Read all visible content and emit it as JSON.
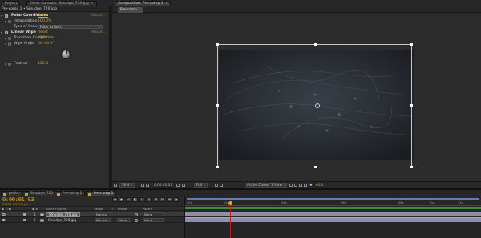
{
  "top_tabs": [
    {
      "label": "Project"
    },
    {
      "label": "Effect Controls: Smudge_720.jpg"
    },
    {
      "label": "Composition: Pre-comp 1"
    }
  ],
  "effect_controls": {
    "header": "Pre-comp 1 • Smudge_720.jpg",
    "polar": {
      "name": "Polar Coordinates",
      "reset": "Reset",
      "about": "About...",
      "interpolation_label": "Interpolation",
      "interpolation_value": "100.0%",
      "conversion_label": "Type of Conversion",
      "conversion_value": "Polar to Rect"
    },
    "wipe": {
      "name": "Linear Wipe",
      "reset": "Reset",
      "about": "About...",
      "completion_label": "Transition Completion",
      "completion_value": "31%",
      "angle_label": "Wipe Angle",
      "angle_value": "0x +0.0°",
      "feather_label": "Feather",
      "feather_value": "182.0"
    }
  },
  "composition": {
    "subtab": "Pre-comp 1"
  },
  "viewer_controls": {
    "zoom": "50%",
    "timecode": "0:00:01:03",
    "resolution": "Full",
    "camera": "Active Camera",
    "views": "1 View",
    "exposure": "+0.0"
  },
  "timeline_tabs": [
    {
      "label": "prelim",
      "color": "#c9a227"
    },
    {
      "label": "Smudge_720",
      "color": "#c9a227"
    },
    {
      "label": "Pre-comp 2",
      "color": "#c9a227"
    },
    {
      "label": "Pre-comp 1",
      "color": "#c9a227"
    }
  ],
  "timeline": {
    "timecode": "0:00:01:03",
    "fps_note": "00028 (25.00 fps)",
    "columns": {
      "source_name": "Source Name",
      "mode": "Mode",
      "t": "T",
      "trkmat": "TrkMat",
      "parent": "Parent"
    },
    "layers": [
      {
        "num": "1",
        "name": "Smudge_720.jpg",
        "mode": "Normal",
        "trkmat": "",
        "parent": "None",
        "label_color": "#a0a0c0"
      },
      {
        "num": "2",
        "name": "Smudge_720.jpg",
        "mode": "Normal",
        "trkmat": "None",
        "parent": "None",
        "label_color": "#a0a0c0"
      }
    ],
    "ruler_ticks": [
      "00s",
      "02s",
      "04s",
      "06s",
      "08s",
      "10s",
      "12s"
    ],
    "tools": [
      "⇄",
      "◉",
      "⌂",
      "◧",
      "⚐",
      "◎",
      "⊞",
      "⊟",
      "⊕",
      "◔"
    ]
  }
}
